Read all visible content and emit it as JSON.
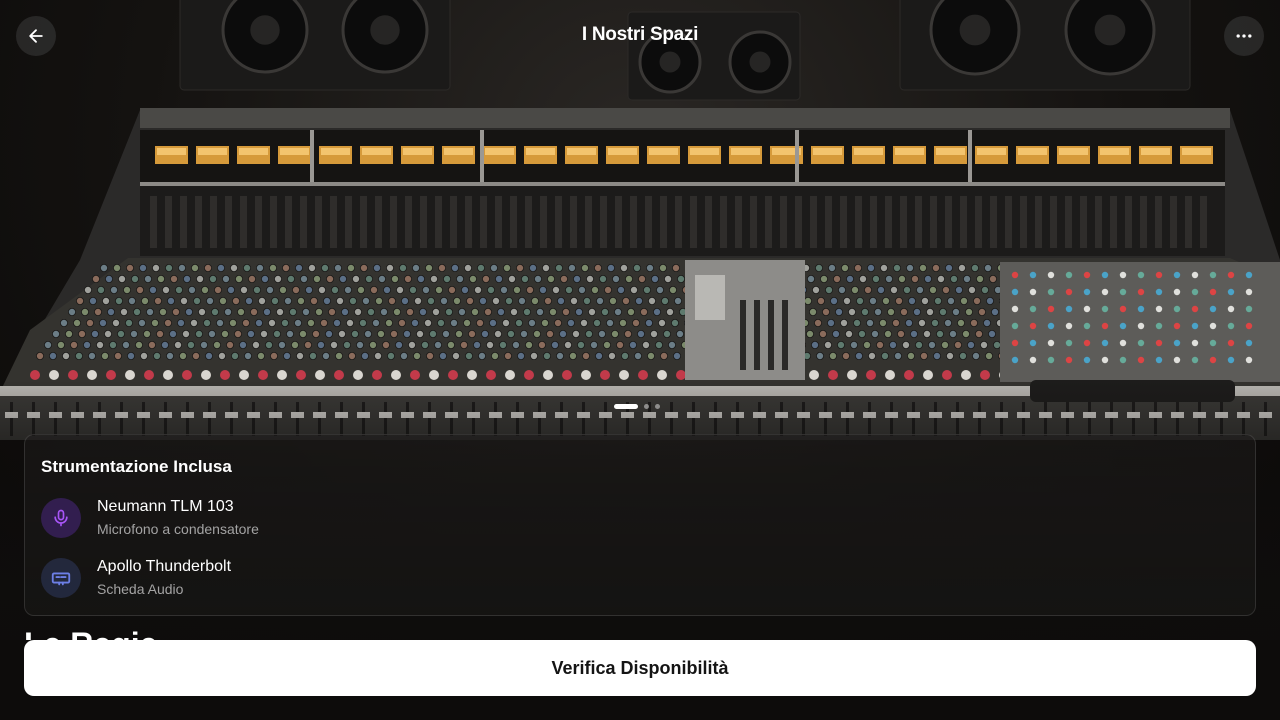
{
  "header": {
    "title": "I Nostri Spazi",
    "back_icon": "arrow-left-icon",
    "more_icon": "more-horizontal-icon"
  },
  "hero": {
    "subject": "mixing-console-photo",
    "carousel": {
      "total": 3,
      "active": 1
    }
  },
  "equipment": {
    "title": "Strumentazione Inclusa",
    "items": [
      {
        "name": "Neumann TLM 103",
        "description": "Microfono a condensatore",
        "icon": "microphone-icon",
        "color": "#7c3aed"
      },
      {
        "name": "Apollo Thunderbolt",
        "description": "Scheda Audio",
        "icon": "audio-interface-icon",
        "color": "#5b6fd6"
      }
    ]
  },
  "next_section": {
    "heading": "Le Regie"
  },
  "cta": {
    "label": "Verifica Disponibilità"
  },
  "colors": {
    "background": "#0b0b0b",
    "accent": "#7c3aed",
    "cta_background": "#ffffff",
    "cta_text": "#141414"
  }
}
